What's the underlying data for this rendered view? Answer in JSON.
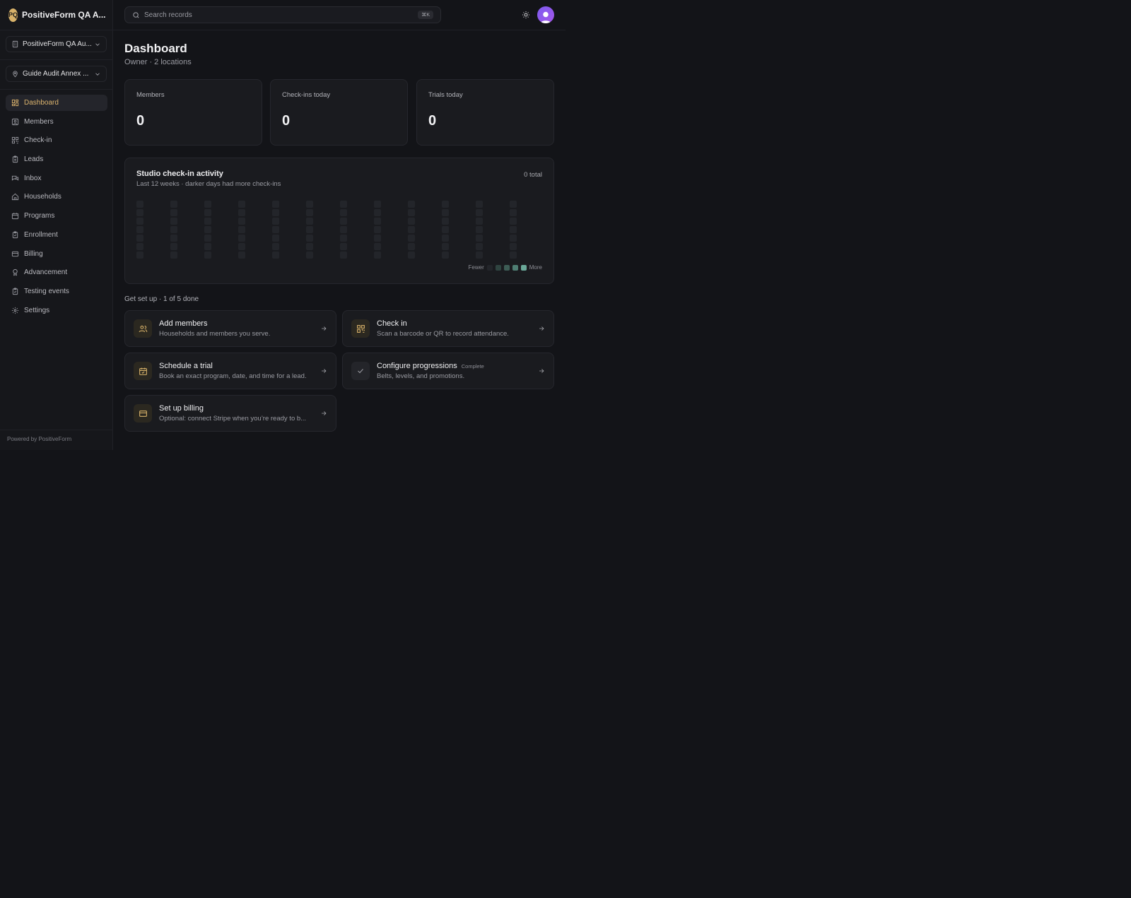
{
  "brand": {
    "initials": "PQ",
    "name": "PositiveForm QA A..."
  },
  "org_picker": {
    "label": "PositiveForm QA Au..."
  },
  "location_picker": {
    "label": "Guide Audit Annex ..."
  },
  "nav": [
    {
      "label": "Dashboard",
      "icon": "dashboard-icon",
      "active": true
    },
    {
      "label": "Members",
      "icon": "members-icon"
    },
    {
      "label": "Check-in",
      "icon": "qr-icon"
    },
    {
      "label": "Leads",
      "icon": "clipboard-icon"
    },
    {
      "label": "Inbox",
      "icon": "chat-icon"
    },
    {
      "label": "Households",
      "icon": "home-icon"
    },
    {
      "label": "Programs",
      "icon": "calendar-icon"
    },
    {
      "label": "Enrollment",
      "icon": "clipboard-check-icon"
    },
    {
      "label": "Billing",
      "icon": "card-icon"
    },
    {
      "label": "Advancement",
      "icon": "award-icon"
    },
    {
      "label": "Testing events",
      "icon": "clipboard-check-icon"
    },
    {
      "label": "Settings",
      "icon": "gear-icon"
    }
  ],
  "footer": {
    "text": "Powered by PositiveForm"
  },
  "search": {
    "placeholder": "Search records",
    "shortcut": "⌘K"
  },
  "page": {
    "title": "Dashboard",
    "subtitle": "Owner · 2 locations"
  },
  "stats": [
    {
      "label": "Members",
      "value": "0"
    },
    {
      "label": "Check-ins today",
      "value": "0"
    },
    {
      "label": "Trials today",
      "value": "0"
    }
  ],
  "activity": {
    "title": "Studio check-in activity",
    "subtitle": "Last 12 weeks · darker days had more check-ins",
    "total": "0 total",
    "weeks": 12,
    "days_per_week": 7,
    "legend_fewer": "Fewer",
    "legend_more": "More",
    "legend_colors": [
      "#23252a",
      "#2f4440",
      "#3d5c55",
      "#4e7d72",
      "#6aa898"
    ]
  },
  "setup": {
    "heading": "Get set up · 1 of 5 done",
    "tasks": [
      {
        "title": "Add members",
        "subtitle": "Households and members you serve.",
        "icon": "members-icon",
        "done": false
      },
      {
        "title": "Check in",
        "subtitle": "Scan a barcode or QR to record attendance.",
        "icon": "qr-icon",
        "done": false
      },
      {
        "title": "Schedule a trial",
        "subtitle": "Book an exact program, date, and time for a lead.",
        "icon": "calendar-check-icon",
        "done": false
      },
      {
        "title": "Configure progressions",
        "badge": "Complete",
        "subtitle": "Belts, levels, and promotions.",
        "icon": "check-icon",
        "done": true
      },
      {
        "title": "Set up billing",
        "subtitle": "Optional: connect Stripe when you’re ready to b...",
        "icon": "card-icon",
        "done": false
      }
    ]
  },
  "colors": {
    "accent": "#dcb46e",
    "background": "#131418",
    "card": "#1a1b1f"
  }
}
